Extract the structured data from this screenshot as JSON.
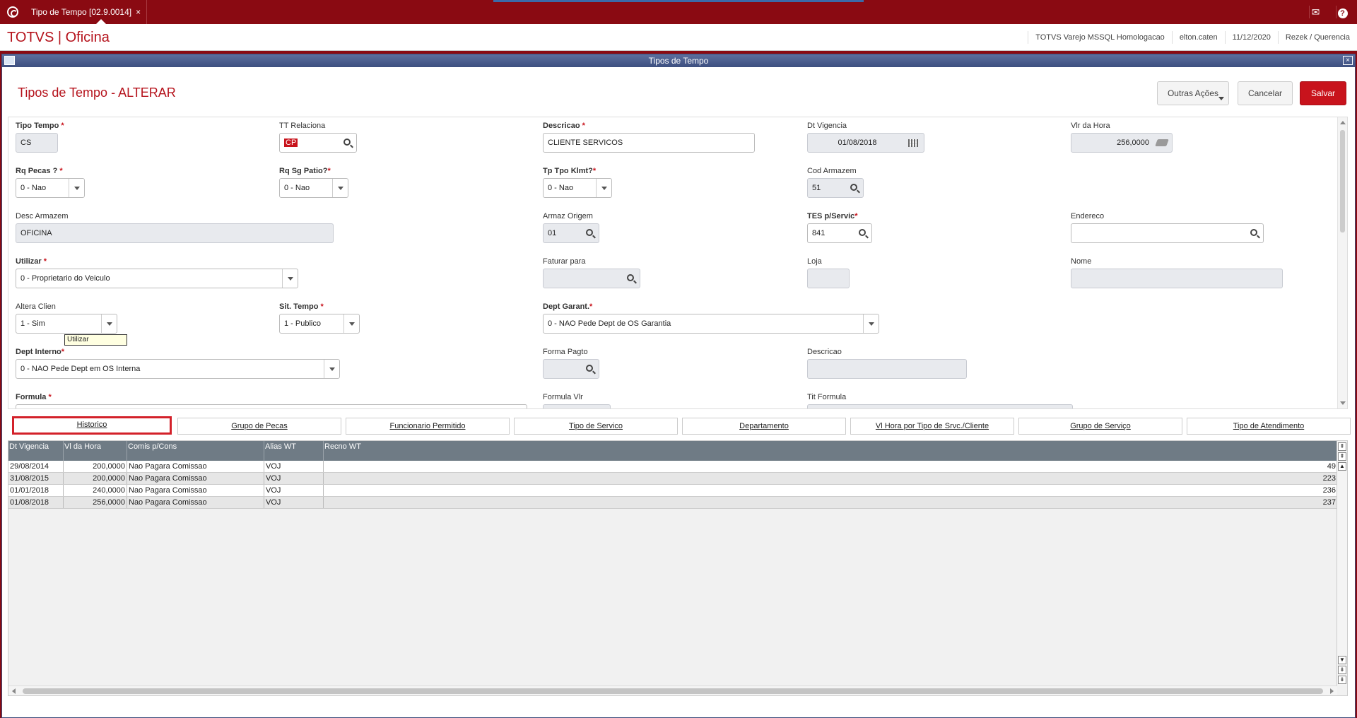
{
  "app": {
    "tab_title": "Tipo de Tempo [02.9.0014]",
    "tab_close": "×",
    "brand": "TOTVS | Oficina",
    "env": "TOTVS Varejo MSSQL Homologacao",
    "user": "elton.caten",
    "date": "11/12/2020",
    "company": "Rezek / Querencia",
    "mail_icon": "✉",
    "help_icon": "?"
  },
  "window": {
    "title": "Tipos de Tempo",
    "close": "×",
    "page_title": "Tipos de Tempo - ALTERAR",
    "btn_outras": "Outras Ações",
    "btn_cancel": "Cancelar",
    "btn_save": "Salvar"
  },
  "form": {
    "tipo_tempo": {
      "label": "Tipo Tempo",
      "value": "CS"
    },
    "tt_relaciona": {
      "label": "TT Relaciona",
      "value": "CP"
    },
    "descricao": {
      "label": "Descricao",
      "value": "CLIENTE SERVICOS"
    },
    "dt_vigencia": {
      "label": "Dt Vigencia",
      "value": "01/08/2018"
    },
    "vlr_hora": {
      "label": "Vlr da Hora",
      "value": "256,0000"
    },
    "rq_pecas": {
      "label": "Rq Pecas ?",
      "value": "0 - Nao"
    },
    "rq_sg_patio": {
      "label": "Rq Sg Patio?",
      "value": "0 - Nao"
    },
    "tp_tpo_klmt": {
      "label": "Tp Tpo Klmt?",
      "value": "0 - Nao"
    },
    "cod_armazem": {
      "label": "Cod Armazem",
      "value": "51"
    },
    "desc_armazem": {
      "label": "Desc Armazem",
      "value": "OFICINA"
    },
    "armaz_origem": {
      "label": "Armaz Origem",
      "value": "01"
    },
    "tes_servic": {
      "label": "TES p/Servic",
      "value": "841"
    },
    "endereco": {
      "label": "Endereco",
      "value": ""
    },
    "utilizar": {
      "label": "Utilizar",
      "value": "0 - Proprietario do Veiculo"
    },
    "faturar_para": {
      "label": "Faturar para",
      "value": ""
    },
    "loja": {
      "label": "Loja",
      "value": ""
    },
    "nome": {
      "label": "Nome",
      "value": ""
    },
    "altera_clien": {
      "label": "Altera Clien",
      "value": "1 - Sim"
    },
    "sit_tempo": {
      "label": "Sit. Tempo",
      "value": "1 - Publico"
    },
    "dept_garant": {
      "label": "Dept Garant.",
      "value": "0 - NAO Pede Dept de OS Garantia"
    },
    "dept_interno": {
      "label": "Dept Interno",
      "value": "0 - NAO Pede Dept em OS Interna"
    },
    "forma_pagto": {
      "label": "Forma Pagto",
      "value": ""
    },
    "descricao2": {
      "label": "Descricao",
      "value": ""
    },
    "formula": {
      "label": "Formula",
      "value": ""
    },
    "formula_vlr": {
      "label": "Formula Vlr",
      "value": ""
    },
    "tit_formula": {
      "label": "Tit Formula",
      "value": ""
    },
    "tooltip": "Utilizar",
    "required_mark": "*"
  },
  "tabs": [
    "Historico",
    "Grupo de Pecas",
    "Funcionario Permitido",
    "Tipo de Servico",
    "Departamento",
    "Vl Hora por Tipo de Srvc./Cliente",
    "Grupo de Serviço",
    "Tipo de Atendimento"
  ],
  "grid": {
    "columns": [
      "Dt Vigencia",
      "Vl da Hora",
      "Comis p/Cons",
      "Alias WT",
      "Recno WT"
    ],
    "rows": [
      [
        "29/08/2014",
        "200,0000",
        "Nao Pagara Comissao",
        "VOJ",
        "49"
      ],
      [
        "31/08/2015",
        "200,0000",
        "Nao Pagara Comissao",
        "VOJ",
        "223"
      ],
      [
        "01/01/2018",
        "240,0000",
        "Nao Pagara Comissao",
        "VOJ",
        "236"
      ],
      [
        "01/08/2018",
        "256,0000",
        "Nao Pagara Comissao",
        "VOJ",
        "237"
      ]
    ],
    "scroll_top": "⇞",
    "scroll_up": "▲",
    "scroll_down": "▼",
    "scroll_pgdown": "⇟",
    "scroll_bottom": "⇟"
  }
}
